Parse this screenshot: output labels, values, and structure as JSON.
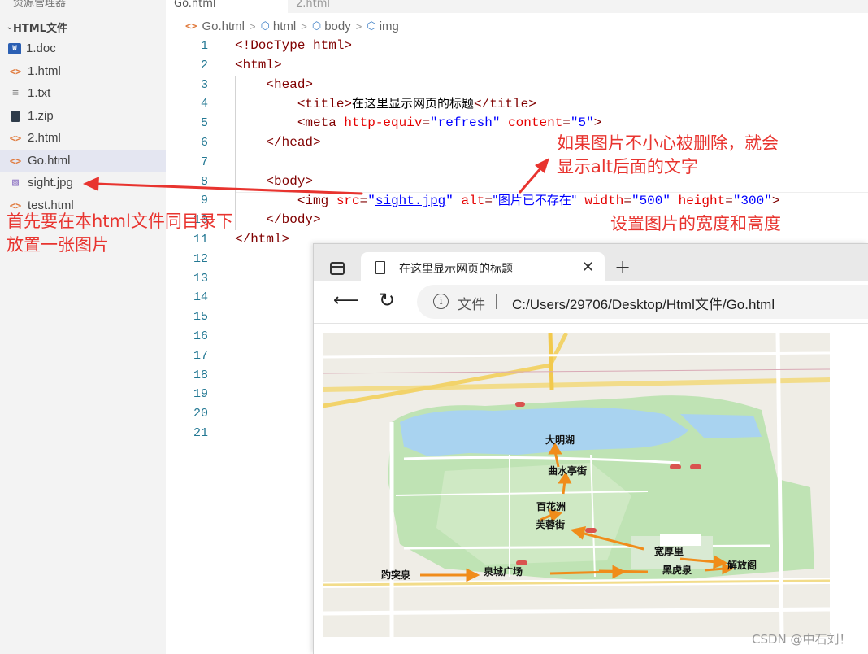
{
  "sidebar": {
    "cut_title": "资源管理器",
    "folder": "HTML文件",
    "files": [
      {
        "name": "1.doc",
        "icon": "word-doc-icon"
      },
      {
        "name": "1.html",
        "icon": "html-file-icon"
      },
      {
        "name": "1.txt",
        "icon": "text-file-icon"
      },
      {
        "name": "1.zip",
        "icon": "zip-file-icon"
      },
      {
        "name": "2.html",
        "icon": "html-file-icon"
      },
      {
        "name": "Go.html",
        "icon": "html-file-icon",
        "selected": true
      },
      {
        "name": "sight.jpg",
        "icon": "image-file-icon"
      },
      {
        "name": "test.html",
        "icon": "html-file-icon"
      }
    ]
  },
  "editor": {
    "tabs": [
      "Go.html",
      "2.html"
    ],
    "breadcrumb": [
      "Go.html",
      "html",
      "body",
      "img"
    ],
    "line_numbers": [
      "1",
      "2",
      "3",
      "4",
      "5",
      "6",
      "7",
      "8",
      "9",
      "10",
      "11",
      "12",
      "13",
      "14",
      "15",
      "16",
      "17",
      "18",
      "19",
      "20",
      "21"
    ],
    "code": {
      "l1": "<!DocType html>",
      "l2": "<html>",
      "l3": "<head>",
      "l4_open": "<title>",
      "l4_text": "在这里显示网页的标题",
      "l4_close": "</title>",
      "l5_tag": "<meta ",
      "l5_attr1": "http-equiv",
      "l5_val1": "\"refresh\"",
      "l5_attr2": "content",
      "l5_val2": "\"5\"",
      "l5_end": ">",
      "l6": "</head>",
      "l8": "<body>",
      "l9_tag": "<img ",
      "l9_src_attr": "src",
      "l9_src_val": "sight.jpg",
      "l9_alt_attr": "alt",
      "l9_alt_val": "\"图片已不存在\"",
      "l9_w_attr": "width",
      "l9_w_val": "\"500\"",
      "l9_h_attr": "height",
      "l9_h_val": "\"300\"",
      "l9_end": ">",
      "l10": "</body>",
      "l11": "</html>"
    }
  },
  "browser": {
    "tab_title": "在这里显示网页的标题",
    "address_label": "文件",
    "url": "C:/Users/29706/Desktop/Html文件/Go.html",
    "map_labels": [
      "大明湖",
      "曲水亭街",
      "百花洲",
      "芙蓉街",
      "宽厚里",
      "解放阁",
      "趵突泉",
      "泉城广场",
      "黑虎泉"
    ]
  },
  "annotations": {
    "left_note": "首先要在本html文件同目录下放置一张图片",
    "alt_note_line1": "如果图片不小心被删除，就会",
    "alt_note_line2": "显示alt后面的文字",
    "size_note": "设置图片的宽度和高度",
    "watermark": "CSDN @中石刘！",
    "color": "#e8342f"
  }
}
